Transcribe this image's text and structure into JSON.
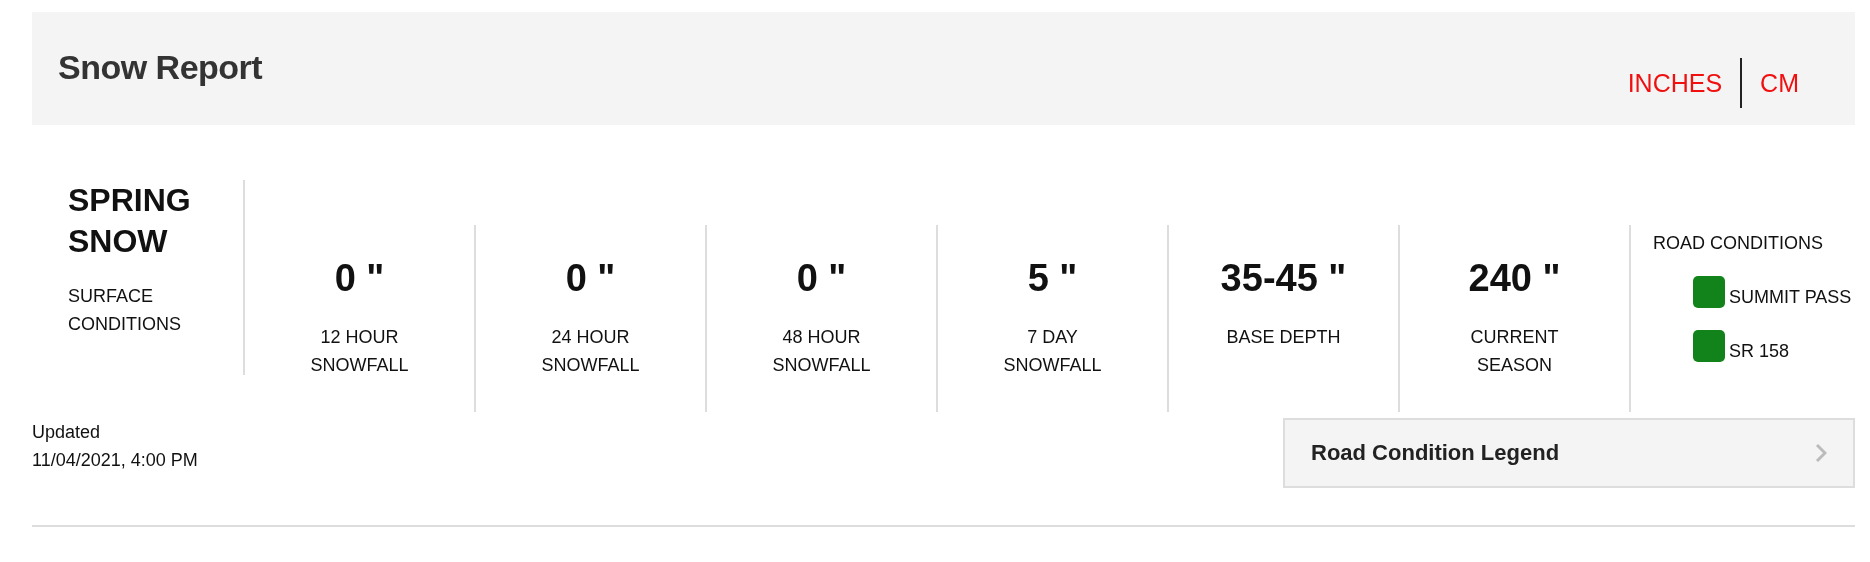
{
  "header": {
    "title": "Snow Report",
    "units": [
      "INCHES",
      "CM"
    ]
  },
  "surface": {
    "value": "SPRING SNOW",
    "label": "SURFACE CONDITIONS"
  },
  "stats": [
    {
      "value": "0 \"",
      "label": "12 HOUR SNOWFALL"
    },
    {
      "value": "0 \"",
      "label": "24 HOUR SNOWFALL"
    },
    {
      "value": "0 \"",
      "label": "48 HOUR SNOWFALL"
    },
    {
      "value": "5 \"",
      "label": "7 DAY SNOWFALL"
    },
    {
      "value": "35-45 \"",
      "label": "BASE DEPTH"
    },
    {
      "value": "240 \"",
      "label": "CURRENT SEASON"
    }
  ],
  "road_conditions": {
    "title": "ROAD CONDITIONS",
    "roads": [
      {
        "name": "SUMMIT PASS",
        "color": "#12821a"
      },
      {
        "name": "SR 158",
        "color": "#12821a"
      }
    ]
  },
  "updated": {
    "label": "Updated",
    "time": "11/04/2021, 4:00 PM"
  },
  "legend_button": {
    "label": "Road Condition Legend"
  }
}
